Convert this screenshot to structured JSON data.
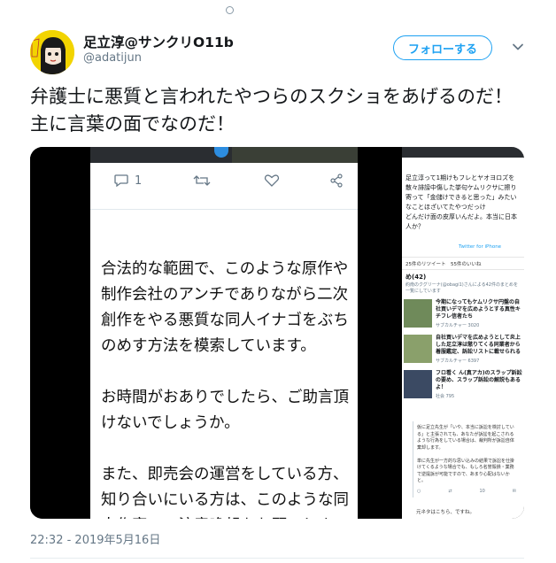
{
  "user": {
    "display_name": "足立淳@サンクリO11b",
    "handle": "@adatijun",
    "follow_label": "フォローする"
  },
  "tweet": {
    "text": "弁護士に悪質と言われたやつらのスクショをあげるのだ！　主に言葉の面でなのだ！",
    "timestamp": "22:32 - 2019年5月16日"
  },
  "screenshot_left": {
    "reply_count": "1",
    "body": "合法的な範囲で、このような原作や制作会社のアンチでありながら二次創作をやる悪質な同人イナゴをぶちのめす方法を模索しています。\n\nお時間がおありでしたら、ご助言頂けないでしょうか。\n\nまた、即売会の運営をしている方、知り合いにいる方は、このような同人作家への注意喚起をお願いしま"
  },
  "screenshot_right": {
    "tweet_text": "足立淳って1期けもフレとヤオヨロズを散々誹謗中傷した挙句ケムリクサに擦り寄って「金儲けできると思った」みたいなことほざいてたやつだっけ\nどんだけ面の皮厚いんだよ。本当に日本人か？",
    "source": "Twitter for iPhone",
    "stats": "25件のリツイート　55件のいいね",
    "list_heading": "め(42)",
    "list_sub": "約南のクグリーナ(@obagi1)さんによる42件のまとめを一覧にしています",
    "cards": [
      {
        "title": "今期になってもケムリクサ円盤の自社買いデマを広めようとする真性キチフレ信者たち",
        "meta": "サブカルチャー 3020"
      },
      {
        "title": "自社買いデマを広めようとして炎上した足立淳は懲りてくる同業者から着服鑑定、訴訟リストに載せられる",
        "meta": "サブカルチャー 6397"
      },
      {
        "title": "フロ看く ん(真アカ)のスラップ訴訟の要め、スラップ訴訟の解説もあるよ！",
        "meta": "社会 795"
      }
    ],
    "box_text": "仮に足立先生が「いや、本当に訴訟を検討している」と主張されても、あなたが訴訟を起こされるような行為をしている場合は、裁判所が訴訟自体棄却します。\n\n単に先生が一方的な思い込みの結果で訴訟を仕掛けてくるような場合でも、もしろ名誉毀損・業務で逆提訴が可能ですので、あまり心配はないかと。",
    "box_actions": [
      "",
      "",
      "10",
      ""
    ],
    "footer": "元ネタはこちら、ですね。"
  }
}
